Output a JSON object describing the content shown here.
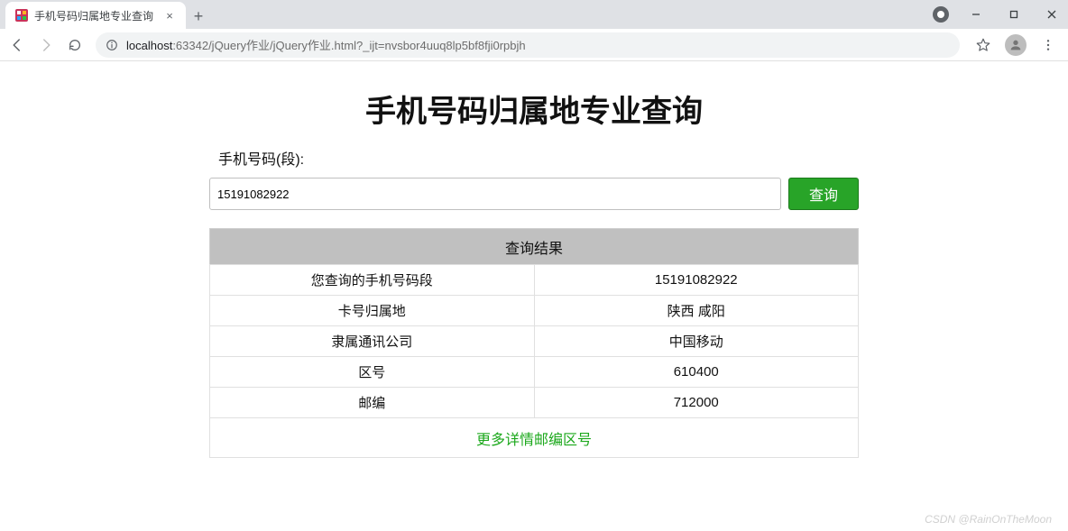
{
  "browser": {
    "tab_title": "手机号码归属地专业查询",
    "url_host": "localhost",
    "url_rest": ":63342/jQuery作业/jQuery作业.html?_ijt=nvsbor4uuq8lp5bf8fji0rpbjh"
  },
  "page": {
    "title": "手机号码归属地专业查询",
    "label": "手机号码(段):",
    "phone_value": "15191082922",
    "query_button": "查询",
    "result_header": "查询结果",
    "rows": {
      "r1_label": "您查询的手机号码段",
      "r1_value": "15191082922",
      "r2_label": "卡号归属地",
      "r2_value": "陕西 咸阳",
      "r3_label": "隶属通讯公司",
      "r3_value": "中国移动",
      "r4_label": "区号",
      "r4_value": "610400",
      "r5_label": "邮编",
      "r5_value": "712000"
    },
    "more_link": "更多详情邮编区号",
    "watermark": "CSDN @RainOnTheMoon"
  }
}
